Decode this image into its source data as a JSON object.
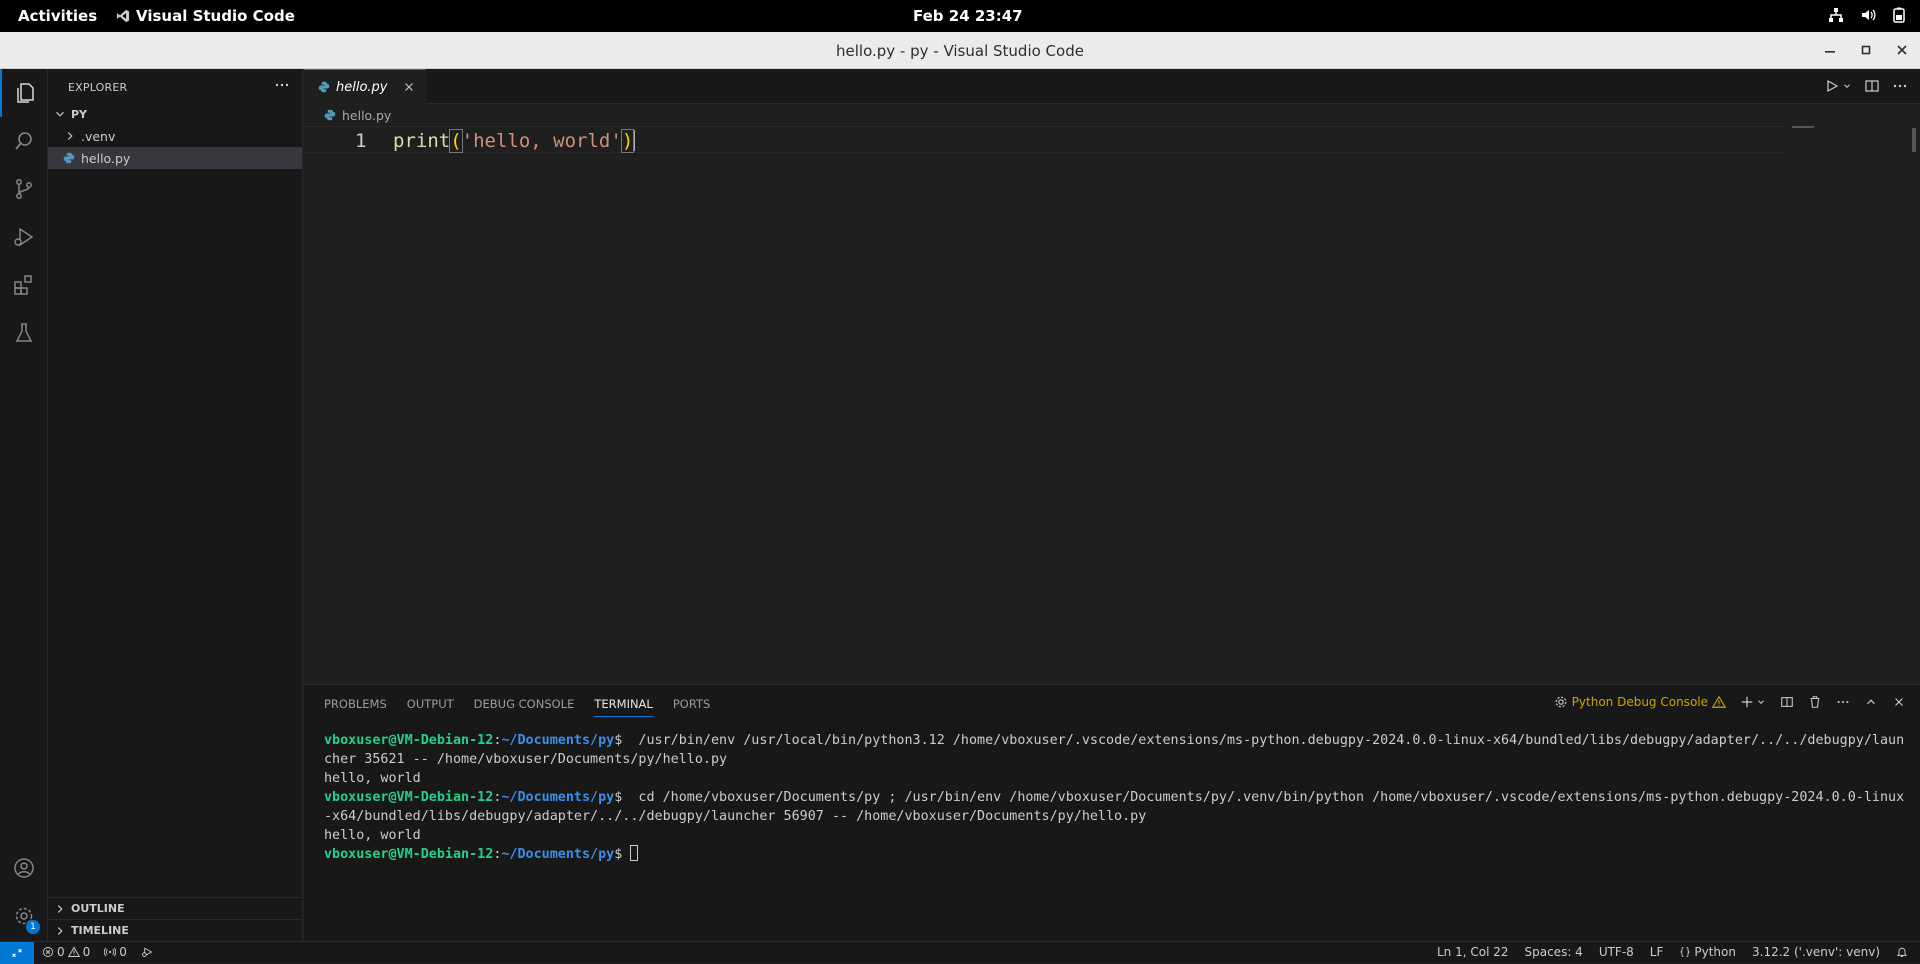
{
  "system_bar": {
    "activities": "Activities",
    "app_name": "Visual Studio Code",
    "clock": "Feb 24  23:47"
  },
  "window": {
    "title": "hello.py - py - Visual Studio Code"
  },
  "activity_bar": {
    "settings_badge": "1"
  },
  "sidebar": {
    "header": "EXPLORER",
    "folder": "PY",
    "tree": [
      {
        "label": ".venv",
        "type": "folder"
      },
      {
        "label": "hello.py",
        "type": "file"
      }
    ],
    "outline": "OUTLINE",
    "timeline": "TIMELINE"
  },
  "editor": {
    "tab_label": "hello.py",
    "breadcrumb": "hello.py",
    "line_number": "1",
    "code": {
      "fn": "print",
      "open": "(",
      "str": "'hello, world'",
      "close": ")"
    }
  },
  "panel": {
    "tabs": [
      "PROBLEMS",
      "OUTPUT",
      "DEBUG CONSOLE",
      "TERMINAL",
      "PORTS"
    ],
    "active_tab": "TERMINAL",
    "debug_console_label": "Python Debug Console",
    "terminal": {
      "prompt_user": "vboxuser@VM-Debian-12",
      "prompt_sep": ":",
      "prompt_path": "~/Documents/py",
      "prompt_end": "$ ",
      "cmd1": " /usr/bin/env /usr/local/bin/python3.12 /home/vboxuser/.vscode/extensions/ms-python.debugpy-2024.0.0-linux-x64/bundled/libs/debugpy/adapter/../../debugpy/launcher 35621 -- /home/vboxuser/Documents/py/hello.py",
      "out1": "hello, world",
      "cmd2": " cd /home/vboxuser/Documents/py ; /usr/bin/env /home/vboxuser/Documents/py/.venv/bin/python /home/vboxuser/.vscode/extensions/ms-python.debugpy-2024.0.0-linux-x64/bundled/libs/debugpy/adapter/../../debugpy/launcher 56907 -- /home/vboxuser/Documents/py/hello.py",
      "out2": "hello, world"
    }
  },
  "status_bar": {
    "errors": "0",
    "warnings": "0",
    "ports": "0",
    "position": "Ln 1, Col 22",
    "spaces": "Spaces: 4",
    "encoding": "UTF-8",
    "eol": "LF",
    "language": "Python",
    "interpreter": "3.12.2 ('.venv': venv)"
  }
}
